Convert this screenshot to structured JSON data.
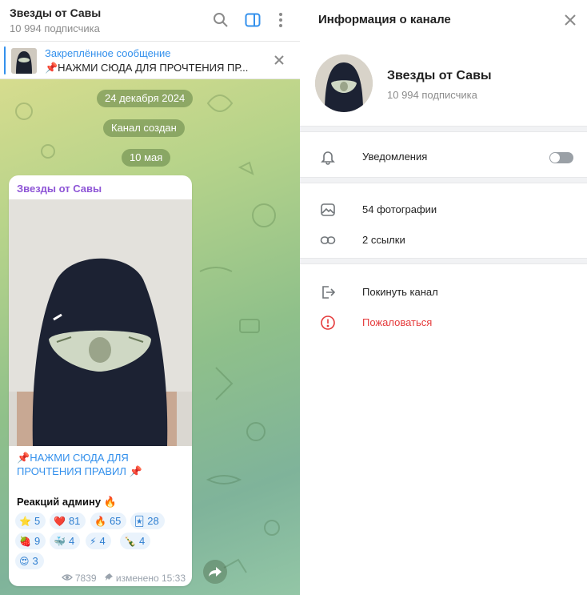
{
  "chat": {
    "title": "Звезды от Савы",
    "subscribers": "10 994 подписчика",
    "pinned": {
      "title": "Закреплённое сообщение",
      "text": "📌НАЖМИ СЮДА ДЛЯ  ПРОЧТЕНИЯ ПР..."
    },
    "dates": [
      "24 декабря 2024",
      "Канал создан",
      "10 мая"
    ],
    "message": {
      "author": "Звезды от Савы",
      "link_text": "НАЖМИ СЮДА ДЛЯ ПРОЧТЕНИЯ ПРАВИЛ",
      "reactions_title": "Реакций админу",
      "reactions": [
        {
          "emoji": "⭐",
          "count": "5"
        },
        {
          "emoji": "❤️",
          "count": "81"
        },
        {
          "emoji": "🔥",
          "count": "65"
        },
        {
          "emoji": "🃏",
          "count": "28"
        },
        {
          "emoji": "🍓",
          "count": "9"
        },
        {
          "emoji": "🐳",
          "count": "4"
        },
        {
          "emoji": "⚡",
          "count": "4"
        },
        {
          "emoji": "🍾",
          "count": "4"
        },
        {
          "emoji": "😍",
          "count": "3"
        }
      ],
      "views": "7839",
      "edited": "изменено 15:33"
    }
  },
  "info": {
    "header_title": "Информация о канале",
    "name": "Звезды от Савы",
    "subscribers": "10 994 подписчика",
    "notifications_label": "Уведомления",
    "notifications_on": false,
    "photos_label": "54 фотографии",
    "links_label": "2 ссылки",
    "leave_label": "Покинуть канал",
    "report_label": "Пожаловаться"
  },
  "icons": [
    "search-icon",
    "sidebar-toggle-icon",
    "more-vertical-icon",
    "close-icon",
    "bell-icon",
    "photo-icon",
    "link-icon",
    "leave-icon",
    "report-icon",
    "eye-icon",
    "pin-icon",
    "forward-icon"
  ],
  "colors": {
    "accent": "#3390ec",
    "danger": "#e5393a",
    "author": "#8e55d6"
  }
}
